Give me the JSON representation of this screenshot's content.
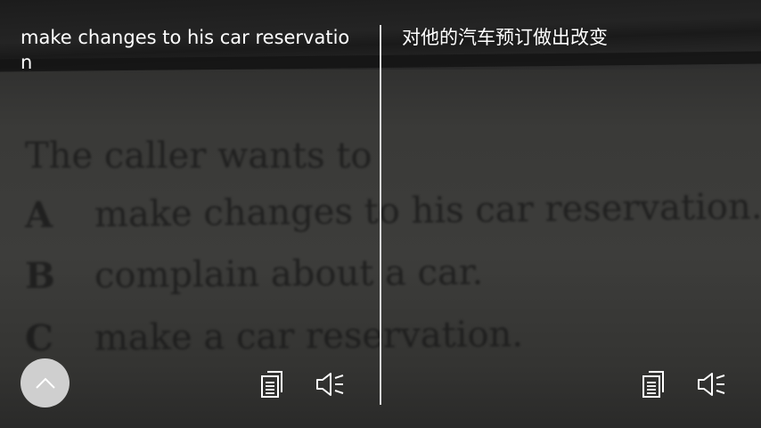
{
  "camera_view": {
    "lines": [
      {
        "letter": "",
        "text": "The caller wants to"
      },
      {
        "letter": "A",
        "text": "make changes to his car reservation."
      },
      {
        "letter": "B",
        "text": "complain about a car."
      },
      {
        "letter": "C",
        "text": "make a car reservation."
      }
    ]
  },
  "translation": {
    "source_text": "make changes to his car reservation",
    "translated_text": "对他的汽车预订做出改变"
  },
  "controls": {
    "collapse_icon": "chevron-up-icon",
    "copy_icon": "copy-icon",
    "speak_icon": "speaker-icon"
  },
  "colors": {
    "text": "#ffffff",
    "divider": "#d8d8d8",
    "collapse_button_bg": "#cfcfcf"
  }
}
